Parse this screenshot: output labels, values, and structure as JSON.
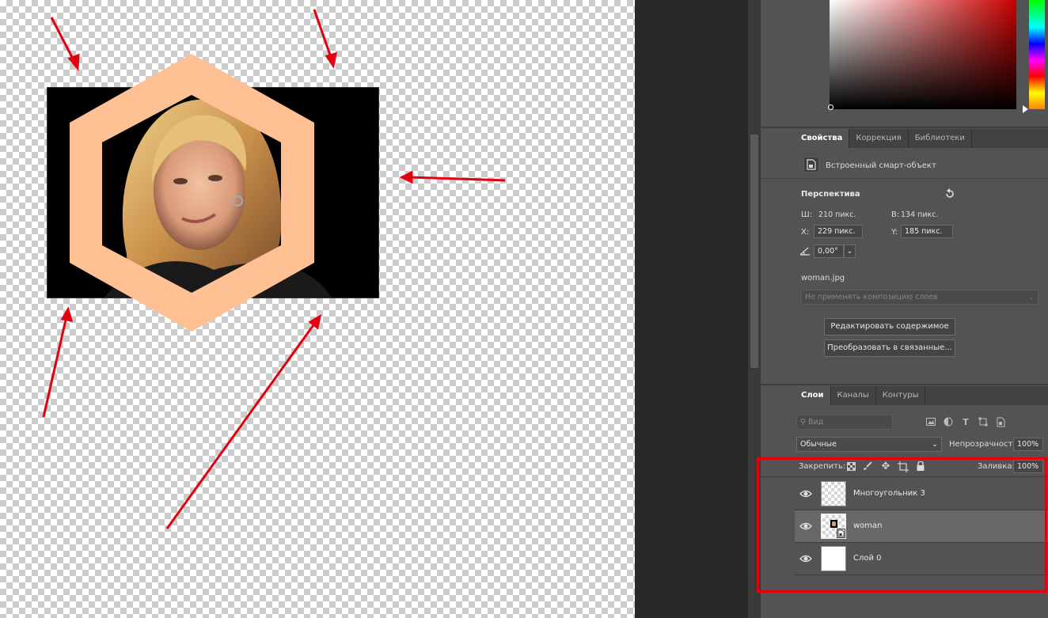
{
  "colors": {
    "hexagon": "#ffc094",
    "annotation": "#e3000f",
    "panel_bg": "#535353",
    "tab_bg": "#424242"
  },
  "properties_tabs": [
    {
      "label": "Свойства",
      "active": true
    },
    {
      "label": "Коррекция",
      "active": false
    },
    {
      "label": "Библиотеки",
      "active": false
    }
  ],
  "properties": {
    "object_type": "Встроенный смарт-объект",
    "object_icon": "smart-object-icon",
    "section_title": "Перспектива",
    "reset_icon": "reset-icon",
    "w_label": "Ш:",
    "w_value": "210 пикс.",
    "h_label": "В:",
    "h_value": "134 пикс.",
    "x_label": "X:",
    "x_value": "229 пикс.",
    "y_label": "Y:",
    "y_value": "185 пикс.",
    "angle_icon": "angle-icon",
    "angle_value": "0,00°",
    "file_name": "woman.jpg",
    "composition_placeholder": "Не применять композицию слоев",
    "edit_button": "Редактировать содержимое",
    "convert_button": "Преобразовать в связанные..."
  },
  "layers_tabs": [
    {
      "label": "Слои",
      "active": true
    },
    {
      "label": "Каналы",
      "active": false
    },
    {
      "label": "Контуры",
      "active": false
    }
  ],
  "layers_panel": {
    "filter_placeholder": "Вид",
    "blend_mode": "Обычные",
    "opacity_label": "Непрозрачность:",
    "opacity_value": "100%",
    "lock_label": "Закрепить:",
    "fill_label": "Заливка:",
    "fill_value": "100%",
    "filter_icons": [
      "image-filter-icon",
      "adjustment-filter-icon",
      "type-filter-icon",
      "shape-filter-icon",
      "smart-filter-icon"
    ],
    "lock_icons": [
      "lock-transparent-icon",
      "lock-brush-icon",
      "lock-move-icon",
      "lock-artboard-icon",
      "lock-all-icon"
    ]
  },
  "layers": [
    {
      "name": "Многоугольник 3",
      "visible": true,
      "selected": false,
      "thumb": "transparent"
    },
    {
      "name": "woman",
      "visible": true,
      "selected": true,
      "thumb": "smart"
    },
    {
      "name": "Слой 0",
      "visible": true,
      "selected": false,
      "thumb": "white"
    }
  ]
}
